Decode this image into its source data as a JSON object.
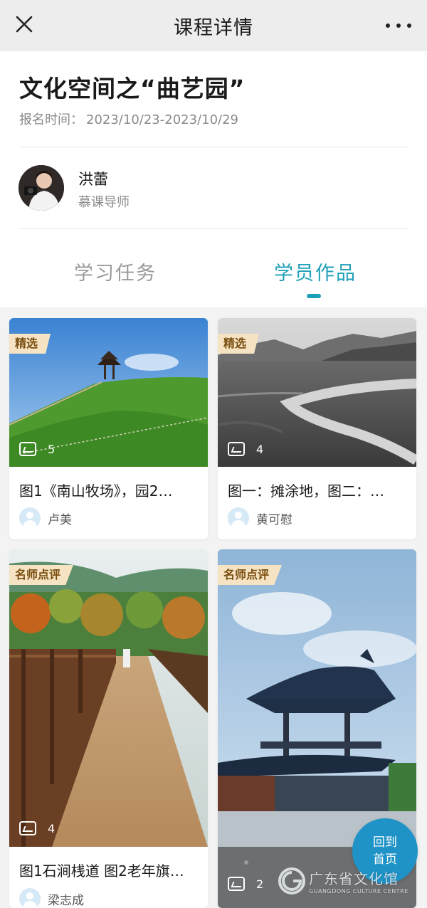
{
  "header": {
    "title": "课程详情",
    "close_icon": "close-icon",
    "more_icon": "more-icon"
  },
  "course": {
    "title": "文化空间之“曲艺园”",
    "registration_label": "报名时间：",
    "registration_range": "2023/10/23-2023/10/29"
  },
  "teacher": {
    "name": "洪蕾",
    "role": "慕课导师"
  },
  "tabs": [
    {
      "label": "学习任务",
      "active": false
    },
    {
      "label": "学员作品",
      "active": true
    }
  ],
  "accent_color": "#1ea0b8",
  "works": [
    {
      "badge": "精选",
      "image_count": "5",
      "caption": "图1《南山牧场》，园2…",
      "author": "卢美"
    },
    {
      "badge": "精选",
      "image_count": "4",
      "caption": "图一：摊涂地，图二：…",
      "author": "黄可慰"
    },
    {
      "badge": "名师点评",
      "image_count": "4",
      "caption": "图1石涧桟道 图2老年旗…",
      "author": "梁志成"
    },
    {
      "badge": "名师点评",
      "image_count": "2",
      "caption": "",
      "author": ""
    }
  ],
  "home_button": {
    "line1": "回到",
    "line2": "首页"
  },
  "watermark": {
    "cn": "广东省文化馆",
    "en": "GUANGDONG CULTURE CENTRE"
  }
}
